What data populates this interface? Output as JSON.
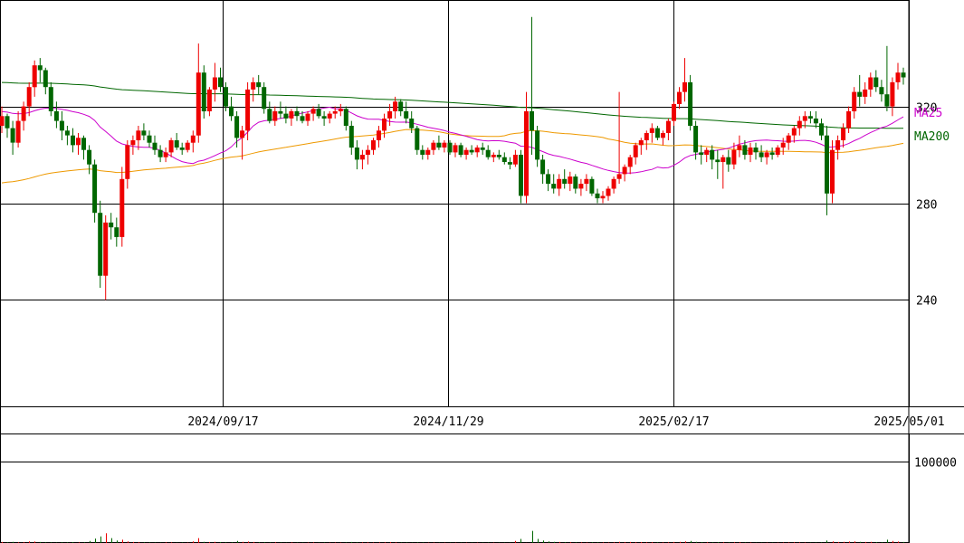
{
  "chart_data": {
    "type": "candlestick",
    "price_axis": {
      "ticks": [
        240,
        280,
        320
      ],
      "range": [
        196,
        364
      ]
    },
    "date_axis": {
      "ticks": [
        "2024/09/17",
        "2024/11/29",
        "2025/02/17",
        "2025/05/01"
      ]
    },
    "volume_axis": {
      "ticks": [
        100000
      ],
      "range": [
        0,
        135000
      ]
    },
    "ma_labels": [
      "MA25",
      "MA200"
    ],
    "colors": {
      "up": "#ee0000",
      "down": "#006600",
      "ma25": "#cc00cc",
      "ma75": "#ee9900",
      "ma200": "#006600",
      "grid": "#000000"
    },
    "candles": [
      [
        312,
        320,
        309,
        316,
        1200
      ],
      [
        316,
        317,
        307,
        311,
        800
      ],
      [
        311,
        314,
        300,
        305,
        1500
      ],
      [
        305,
        318,
        303,
        314,
        900
      ],
      [
        314,
        322,
        310,
        320,
        1000
      ],
      [
        320,
        330,
        316,
        328,
        2000
      ],
      [
        328,
        339,
        324,
        337,
        1800
      ],
      [
        337,
        340,
        330,
        335,
        1200
      ],
      [
        335,
        336,
        325,
        328,
        900
      ],
      [
        328,
        330,
        316,
        318,
        700
      ],
      [
        318,
        322,
        311,
        314,
        600
      ],
      [
        314,
        318,
        306,
        310,
        900
      ],
      [
        310,
        312,
        304,
        308,
        800
      ],
      [
        308,
        311,
        301,
        304,
        1100
      ],
      [
        304,
        309,
        300,
        307,
        700
      ],
      [
        307,
        308,
        298,
        302,
        900
      ],
      [
        302,
        304,
        292,
        296,
        2500
      ],
      [
        296,
        298,
        272,
        276,
        5500
      ],
      [
        276,
        281,
        245,
        250,
        8000
      ],
      [
        250,
        275,
        240,
        272,
        12000
      ],
      [
        272,
        276,
        265,
        270,
        6000
      ],
      [
        270,
        274,
        262,
        266,
        3000
      ],
      [
        266,
        295,
        262,
        290,
        4000
      ],
      [
        290,
        306,
        286,
        304,
        2000
      ],
      [
        304,
        308,
        300,
        306,
        1200
      ],
      [
        306,
        312,
        302,
        310,
        1000
      ],
      [
        310,
        313,
        306,
        308,
        900
      ],
      [
        308,
        310,
        303,
        305,
        700
      ],
      [
        305,
        308,
        300,
        302,
        600
      ],
      [
        302,
        304,
        297,
        299,
        500
      ],
      [
        299,
        303,
        297,
        301,
        800
      ],
      [
        301,
        307,
        299,
        306,
        700
      ],
      [
        306,
        309,
        302,
        303,
        500
      ],
      [
        303,
        305,
        300,
        302,
        600
      ],
      [
        302,
        306,
        301,
        305,
        500
      ],
      [
        305,
        310,
        301,
        308,
        2000
      ],
      [
        308,
        346,
        305,
        334,
        6000
      ],
      [
        334,
        337,
        315,
        318,
        1500
      ],
      [
        318,
        328,
        316,
        327,
        1000
      ],
      [
        327,
        338,
        322,
        332,
        1500
      ],
      [
        332,
        336,
        326,
        328,
        1100
      ],
      [
        328,
        330,
        318,
        320,
        900
      ],
      [
        320,
        324,
        314,
        316,
        800
      ],
      [
        316,
        318,
        303,
        307,
        2500
      ],
      [
        307,
        312,
        298,
        310,
        1500
      ],
      [
        310,
        330,
        306,
        327,
        1800
      ],
      [
        327,
        332,
        322,
        330,
        1200
      ],
      [
        330,
        333,
        325,
        328,
        1000
      ],
      [
        328,
        330,
        317,
        319,
        900
      ],
      [
        319,
        322,
        313,
        314,
        700
      ],
      [
        314,
        320,
        312,
        318,
        800
      ],
      [
        318,
        322,
        315,
        317,
        600
      ],
      [
        317,
        320,
        313,
        315,
        500
      ],
      [
        315,
        319,
        312,
        318,
        700
      ],
      [
        318,
        320,
        314,
        316,
        600
      ],
      [
        316,
        318,
        313,
        314,
        500
      ],
      [
        314,
        318,
        312,
        317,
        600
      ],
      [
        317,
        320,
        314,
        319,
        700
      ],
      [
        319,
        321,
        315,
        316,
        500
      ],
      [
        316,
        318,
        312,
        315,
        600
      ],
      [
        315,
        318,
        313,
        317,
        500
      ],
      [
        317,
        320,
        315,
        318,
        600
      ],
      [
        318,
        321,
        316,
        319,
        500
      ],
      [
        319,
        320,
        310,
        312,
        700
      ],
      [
        312,
        314,
        300,
        303,
        1200
      ],
      [
        303,
        306,
        294,
        298,
        900
      ],
      [
        298,
        302,
        294,
        300,
        700
      ],
      [
        300,
        304,
        296,
        302,
        800
      ],
      [
        302,
        307,
        300,
        306,
        600
      ],
      [
        306,
        312,
        303,
        310,
        700
      ],
      [
        310,
        317,
        307,
        315,
        900
      ],
      [
        315,
        321,
        312,
        318,
        1000
      ],
      [
        318,
        324,
        315,
        322,
        800
      ],
      [
        322,
        323,
        316,
        318,
        600
      ],
      [
        318,
        322,
        313,
        315,
        700
      ],
      [
        315,
        318,
        309,
        311,
        500
      ],
      [
        311,
        312,
        300,
        302,
        900
      ],
      [
        302,
        304,
        298,
        300,
        600
      ],
      [
        300,
        303,
        298,
        302,
        500
      ],
      [
        302,
        306,
        300,
        305,
        600
      ],
      [
        305,
        308,
        302,
        303,
        500
      ],
      [
        303,
        306,
        301,
        305,
        400
      ],
      [
        305,
        306,
        300,
        301,
        500
      ],
      [
        301,
        305,
        299,
        304,
        400
      ],
      [
        304,
        305,
        299,
        300,
        500
      ],
      [
        300,
        303,
        298,
        302,
        400
      ],
      [
        302,
        304,
        300,
        301,
        500
      ],
      [
        301,
        304,
        299,
        303,
        400
      ],
      [
        303,
        305,
        300,
        302,
        500
      ],
      [
        302,
        304,
        298,
        299,
        600
      ],
      [
        299,
        301,
        297,
        300,
        400
      ],
      [
        300,
        302,
        298,
        299,
        500
      ],
      [
        299,
        301,
        296,
        297,
        400
      ],
      [
        297,
        299,
        294,
        296,
        500
      ],
      [
        296,
        302,
        295,
        300,
        2500
      ],
      [
        300,
        302,
        280,
        283,
        5000
      ],
      [
        283,
        326,
        280,
        318,
        100
      ],
      [
        318,
        357,
        300,
        310,
        15000
      ],
      [
        310,
        312,
        295,
        298,
        5000
      ],
      [
        298,
        300,
        288,
        292,
        3000
      ],
      [
        292,
        294,
        285,
        288,
        2000
      ],
      [
        288,
        292,
        284,
        286,
        1500
      ],
      [
        286,
        292,
        283,
        290,
        1200
      ],
      [
        290,
        294,
        286,
        288,
        1000
      ],
      [
        288,
        293,
        285,
        291,
        900
      ],
      [
        291,
        292,
        284,
        286,
        800
      ],
      [
        286,
        290,
        283,
        288,
        700
      ],
      [
        288,
        292,
        285,
        290,
        600
      ],
      [
        290,
        291,
        283,
        284,
        900
      ],
      [
        284,
        286,
        280,
        282,
        800
      ],
      [
        282,
        285,
        280,
        283,
        700
      ],
      [
        283,
        287,
        281,
        286,
        600
      ],
      [
        286,
        291,
        284,
        290,
        800
      ],
      [
        290,
        326,
        288,
        292,
        1500
      ],
      [
        292,
        296,
        289,
        295,
        1000
      ],
      [
        295,
        300,
        292,
        299,
        1200
      ],
      [
        299,
        305,
        296,
        304,
        1000
      ],
      [
        304,
        307,
        300,
        306,
        1100
      ],
      [
        306,
        310,
        302,
        309,
        900
      ],
      [
        309,
        313,
        305,
        311,
        1000
      ],
      [
        311,
        312,
        306,
        307,
        800
      ],
      [
        307,
        310,
        304,
        309,
        700
      ],
      [
        309,
        315,
        306,
        314,
        900
      ],
      [
        314,
        322,
        312,
        321,
        1200
      ],
      [
        321,
        328,
        319,
        326,
        1500
      ],
      [
        326,
        340,
        322,
        330,
        2000
      ],
      [
        330,
        333,
        310,
        312,
        2500
      ],
      [
        312,
        314,
        298,
        301,
        1500
      ],
      [
        301,
        304,
        296,
        300,
        1000
      ],
      [
        300,
        303,
        297,
        302,
        800
      ],
      [
        302,
        304,
        294,
        298,
        700
      ],
      [
        298,
        302,
        290,
        297,
        1100
      ],
      [
        297,
        300,
        286,
        299,
        900
      ],
      [
        299,
        302,
        293,
        296,
        700
      ],
      [
        296,
        305,
        294,
        302,
        800
      ],
      [
        302,
        308,
        299,
        304,
        1000
      ],
      [
        304,
        306,
        298,
        300,
        700
      ],
      [
        300,
        305,
        297,
        303,
        600
      ],
      [
        303,
        305,
        298,
        301,
        500
      ],
      [
        301,
        304,
        297,
        299,
        400
      ],
      [
        299,
        302,
        296,
        301,
        500
      ],
      [
        301,
        303,
        298,
        300,
        400
      ],
      [
        300,
        304,
        299,
        303,
        500
      ],
      [
        303,
        307,
        300,
        305,
        600
      ],
      [
        305,
        309,
        302,
        308,
        700
      ],
      [
        308,
        312,
        305,
        311,
        800
      ],
      [
        311,
        316,
        308,
        314,
        700
      ],
      [
        314,
        318,
        311,
        316,
        600
      ],
      [
        316,
        318,
        313,
        315,
        500
      ],
      [
        315,
        318,
        311,
        313,
        600
      ],
      [
        313,
        315,
        306,
        308,
        700
      ],
      [
        308,
        312,
        275,
        284,
        3000
      ],
      [
        284,
        306,
        280,
        302,
        2000
      ],
      [
        302,
        308,
        298,
        306,
        1200
      ],
      [
        306,
        313,
        303,
        311,
        1500
      ],
      [
        311,
        320,
        309,
        318,
        1800
      ],
      [
        318,
        328,
        315,
        326,
        2000
      ],
      [
        326,
        333,
        320,
        324,
        1500
      ],
      [
        324,
        330,
        321,
        327,
        1200
      ],
      [
        327,
        334,
        324,
        332,
        1300
      ],
      [
        332,
        335,
        326,
        328,
        1100
      ],
      [
        328,
        331,
        322,
        325,
        900
      ],
      [
        325,
        345,
        318,
        320,
        4000
      ],
      [
        320,
        332,
        316,
        330,
        2500
      ],
      [
        330,
        338,
        327,
        334,
        1800
      ],
      [
        334,
        336,
        329,
        332,
        1200
      ]
    ]
  }
}
